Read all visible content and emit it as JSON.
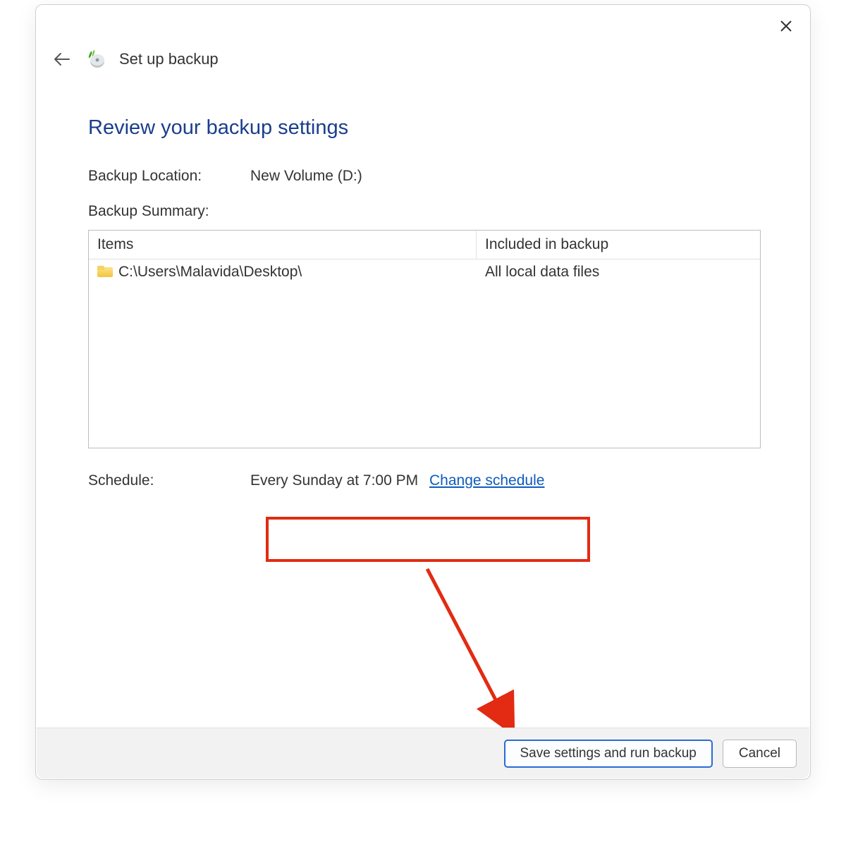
{
  "window": {
    "title": "Set up backup"
  },
  "heading": "Review your backup settings",
  "location": {
    "label": "Backup Location:",
    "value": "New Volume (D:)"
  },
  "summary": {
    "label": "Backup Summary:",
    "columns": {
      "items": "Items",
      "included": "Included in backup"
    },
    "rows": [
      {
        "path": "C:\\Users\\Malavida\\Desktop\\",
        "included": "All local data files"
      }
    ]
  },
  "schedule": {
    "label": "Schedule:",
    "value": "Every Sunday at 7:00 PM",
    "change_link": "Change schedule"
  },
  "footer": {
    "primary": "Save settings and run backup",
    "cancel": "Cancel"
  },
  "annotation": {
    "highlight_target": "schedule-row",
    "arrow_target": "save-button",
    "color": "#e22b12"
  }
}
